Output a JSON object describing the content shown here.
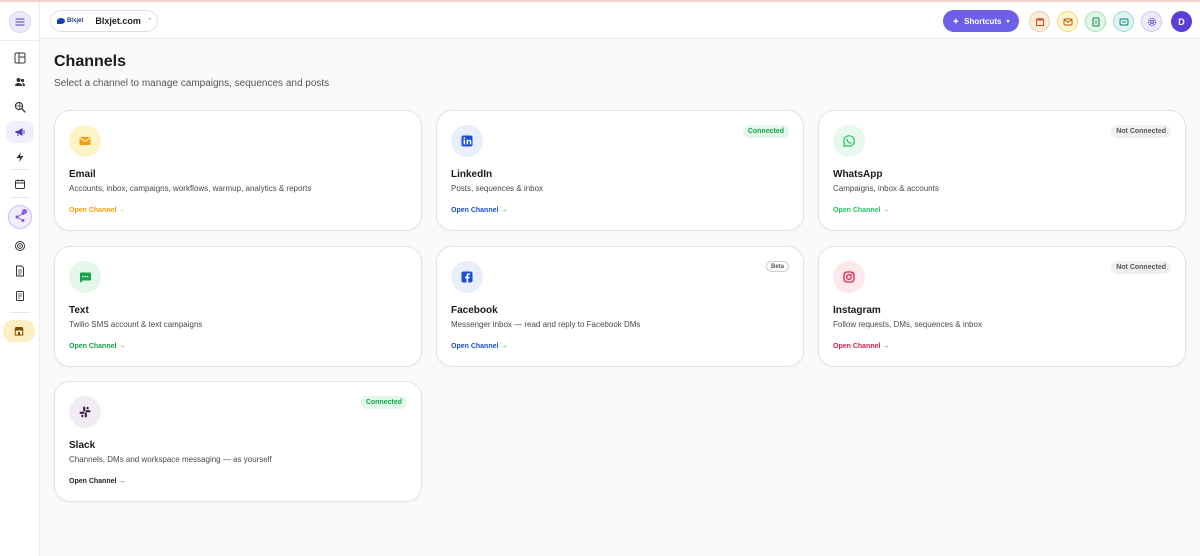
{
  "workspace": {
    "logo_text": "Blxjet",
    "name": "Blxjet.com"
  },
  "topbar": {
    "shortcuts_label": "Shortcuts",
    "avatar_initial": "D"
  },
  "page": {
    "title": "Channels",
    "subtitle": "Select a channel to manage campaigns, sequences and posts"
  },
  "channels": [
    {
      "name": "Email",
      "description": "Accounts, inbox, campaigns, workflows, warmup, analytics & reports",
      "link": "Open Channel →",
      "badge": "",
      "accent": "#f59e0b",
      "icon_bg": "#fef3c7",
      "icon": "mail-icon"
    },
    {
      "name": "LinkedIn",
      "description": "Posts, sequences & inbox",
      "link": "Open Channel →",
      "badge": "Connected",
      "accent": "#1d4ed8",
      "icon_bg": "#e8effb",
      "icon": "linkedin-icon"
    },
    {
      "name": "WhatsApp",
      "description": "Campaigns, inbox & accounts",
      "link": "Open Channel →",
      "badge": "Not Connected",
      "accent": "#22c55e",
      "icon_bg": "#e7f8ee",
      "icon": "whatsapp-icon"
    },
    {
      "name": "Text",
      "description": "Twilio SMS account & text campaigns",
      "link": "Open Channel →",
      "badge": "",
      "accent": "#16a34a",
      "icon_bg": "#e3f7ea",
      "icon": "message-icon"
    },
    {
      "name": "Facebook",
      "description": "Messenger inbox — read and reply to Facebook DMs",
      "link": "Open Channel →",
      "badge": "Beta",
      "accent": "#1d4ed8",
      "icon_bg": "#e8effb",
      "icon": "facebook-icon"
    },
    {
      "name": "Instagram",
      "description": "Follow requests, DMs, sequences & inbox",
      "link": "Open Channel →",
      "badge": "Not Connected",
      "accent": "#e11d48",
      "icon_bg": "#fde8ec",
      "icon": "instagram-icon"
    },
    {
      "name": "Slack",
      "description": "Channels, DMs and workspace messaging — as yourself",
      "link": "Open Channel →",
      "badge": "Connected",
      "accent": "#1f1f1f",
      "icon_bg": "#f1ecf4",
      "icon": "slack-icon"
    }
  ]
}
